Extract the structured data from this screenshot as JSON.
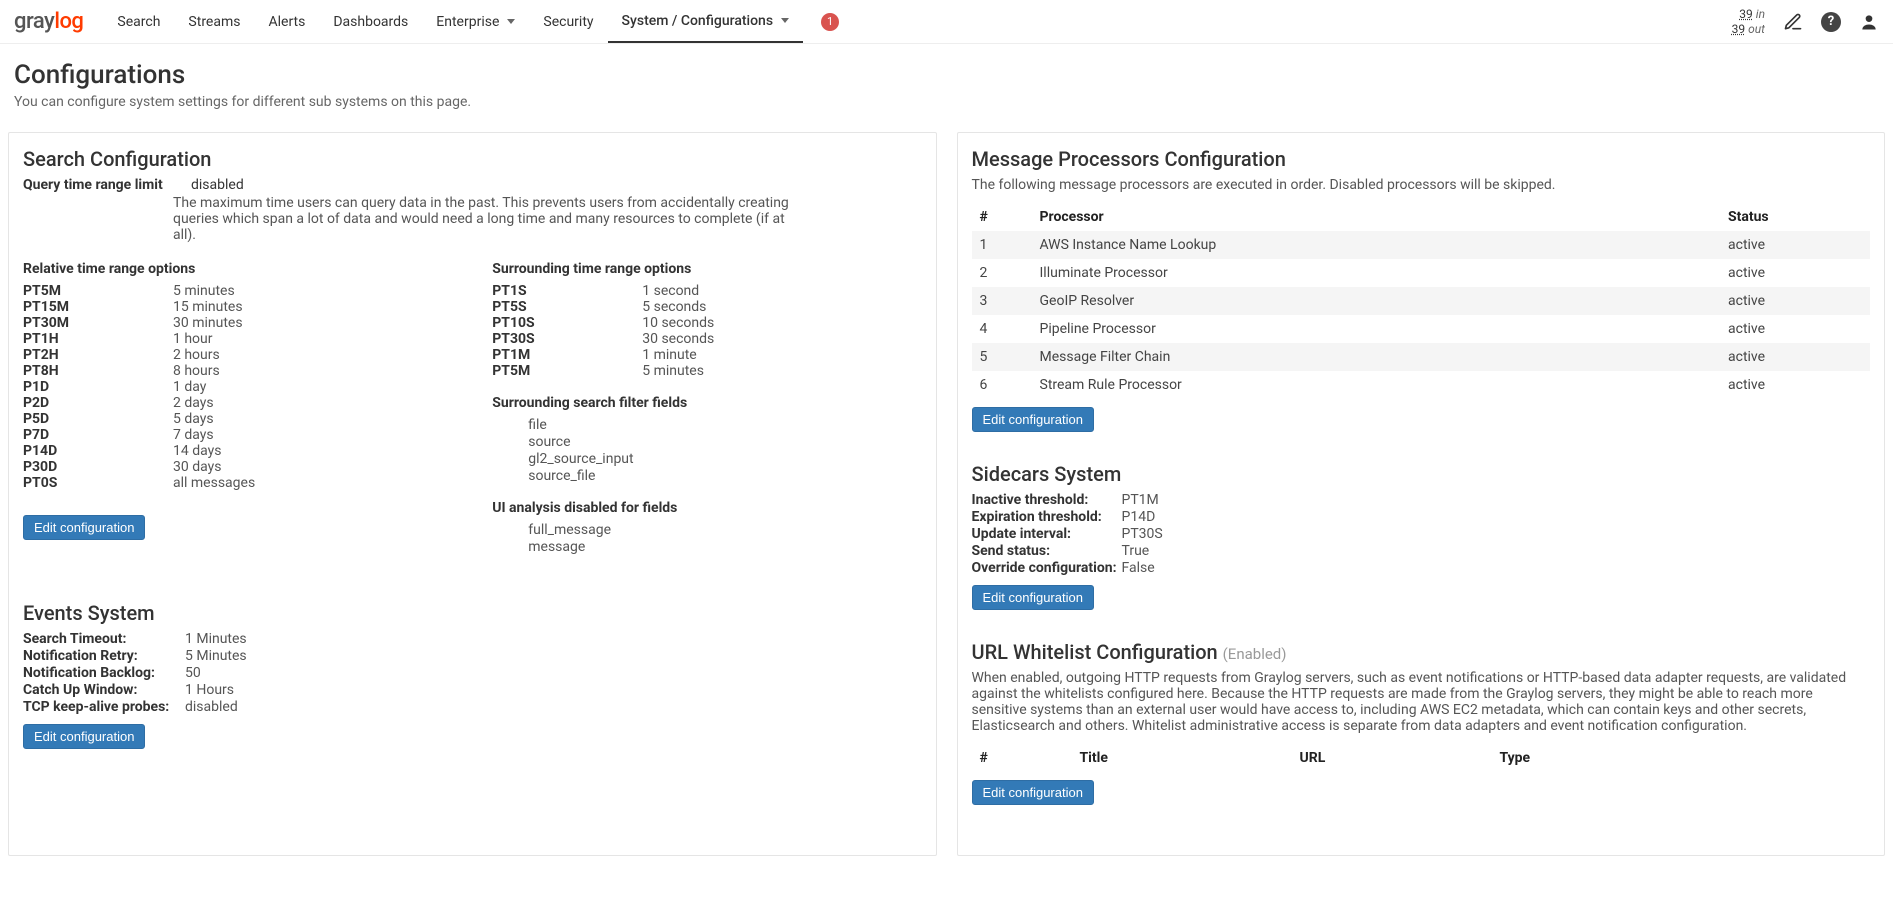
{
  "logo": {
    "part1": "gray",
    "part2": "log"
  },
  "nav": {
    "items": [
      {
        "label": "Search"
      },
      {
        "label": "Streams"
      },
      {
        "label": "Alerts"
      },
      {
        "label": "Dashboards"
      },
      {
        "label": "Enterprise",
        "dropdown": true
      },
      {
        "label": "Security"
      },
      {
        "label": "System / Configurations",
        "dropdown": true,
        "active": true
      }
    ],
    "badge": "1",
    "throughput": {
      "in_count": "39",
      "in_label": "in",
      "out_count": "39",
      "out_label": "out"
    }
  },
  "page": {
    "title": "Configurations",
    "subtitle": "You can configure system settings for different sub systems on this page."
  },
  "search_config": {
    "title": "Search Configuration",
    "limit_label": "Query time range limit",
    "limit_value": "disabled",
    "limit_desc": "The maximum time users can query data in the past. This prevents users from accidentally creating queries which span a lot of data and would need a long time and many resources to complete (if at all).",
    "relative_title": "Relative time range options",
    "relative": [
      {
        "k": "PT5M",
        "v": "5 minutes"
      },
      {
        "k": "PT15M",
        "v": "15 minutes"
      },
      {
        "k": "PT30M",
        "v": "30 minutes"
      },
      {
        "k": "PT1H",
        "v": "1 hour"
      },
      {
        "k": "PT2H",
        "v": "2 hours"
      },
      {
        "k": "PT8H",
        "v": "8 hours"
      },
      {
        "k": "P1D",
        "v": "1 day"
      },
      {
        "k": "P2D",
        "v": "2 days"
      },
      {
        "k": "P5D",
        "v": "5 days"
      },
      {
        "k": "P7D",
        "v": "7 days"
      },
      {
        "k": "P14D",
        "v": "14 days"
      },
      {
        "k": "P30D",
        "v": "30 days"
      },
      {
        "k": "PT0S",
        "v": "all messages"
      }
    ],
    "surrounding_title": "Surrounding time range options",
    "surrounding": [
      {
        "k": "PT1S",
        "v": "1 second"
      },
      {
        "k": "PT5S",
        "v": "5 seconds"
      },
      {
        "k": "PT10S",
        "v": "10 seconds"
      },
      {
        "k": "PT30S",
        "v": "30 seconds"
      },
      {
        "k": "PT1M",
        "v": "1 minute"
      },
      {
        "k": "PT5M",
        "v": "5 minutes"
      }
    ],
    "filter_fields_title": "Surrounding search filter fields",
    "filter_fields": [
      "file",
      "source",
      "gl2_source_input",
      "source_file"
    ],
    "disabled_fields_title": "UI analysis disabled for fields",
    "disabled_fields": [
      "full_message",
      "message"
    ],
    "edit_label": "Edit configuration"
  },
  "events": {
    "title": "Events System",
    "rows": [
      {
        "k": "Search Timeout:",
        "v": "1 Minutes"
      },
      {
        "k": "Notification Retry:",
        "v": "5 Minutes"
      },
      {
        "k": "Notification Backlog:",
        "v": "50"
      },
      {
        "k": "Catch Up Window:",
        "v": "1 Hours"
      },
      {
        "k": "TCP keep-alive probes:",
        "v": "disabled"
      }
    ],
    "edit_label": "Edit configuration"
  },
  "processors": {
    "title": "Message Processors Configuration",
    "desc": "The following message processors are executed in order. Disabled processors will be skipped.",
    "headers": {
      "num": "#",
      "proc": "Processor",
      "status": "Status"
    },
    "rows": [
      {
        "n": "1",
        "name": "AWS Instance Name Lookup",
        "status": "active"
      },
      {
        "n": "2",
        "name": "Illuminate Processor",
        "status": "active"
      },
      {
        "n": "3",
        "name": "GeoIP Resolver",
        "status": "active"
      },
      {
        "n": "4",
        "name": "Pipeline Processor",
        "status": "active"
      },
      {
        "n": "5",
        "name": "Message Filter Chain",
        "status": "active"
      },
      {
        "n": "6",
        "name": "Stream Rule Processor",
        "status": "active"
      }
    ],
    "edit_label": "Edit configuration"
  },
  "sidecars": {
    "title": "Sidecars System",
    "rows": [
      {
        "k": "Inactive threshold:",
        "v": "PT1M"
      },
      {
        "k": "Expiration threshold:",
        "v": "P14D"
      },
      {
        "k": "Update interval:",
        "v": "PT30S"
      },
      {
        "k": "Send status:",
        "v": "True"
      },
      {
        "k": "Override configuration:",
        "v": "False"
      }
    ],
    "edit_label": "Edit configuration"
  },
  "whitelist": {
    "title": "URL Whitelist Configuration",
    "status": "(Enabled)",
    "desc": "When enabled, outgoing HTTP requests from Graylog servers, such as event notifications or HTTP-based data adapter requests, are validated against the whitelists configured here. Because the HTTP requests are made from the Graylog servers, they might be able to reach more sensitive systems than an external user would have access to, including AWS EC2 metadata, which can contain keys and other secrets, Elasticsearch and others. Whitelist administrative access is separate from data adapters and event notification configuration.",
    "headers": {
      "num": "#",
      "title": "Title",
      "url": "URL",
      "type": "Type"
    },
    "edit_label": "Edit configuration"
  }
}
